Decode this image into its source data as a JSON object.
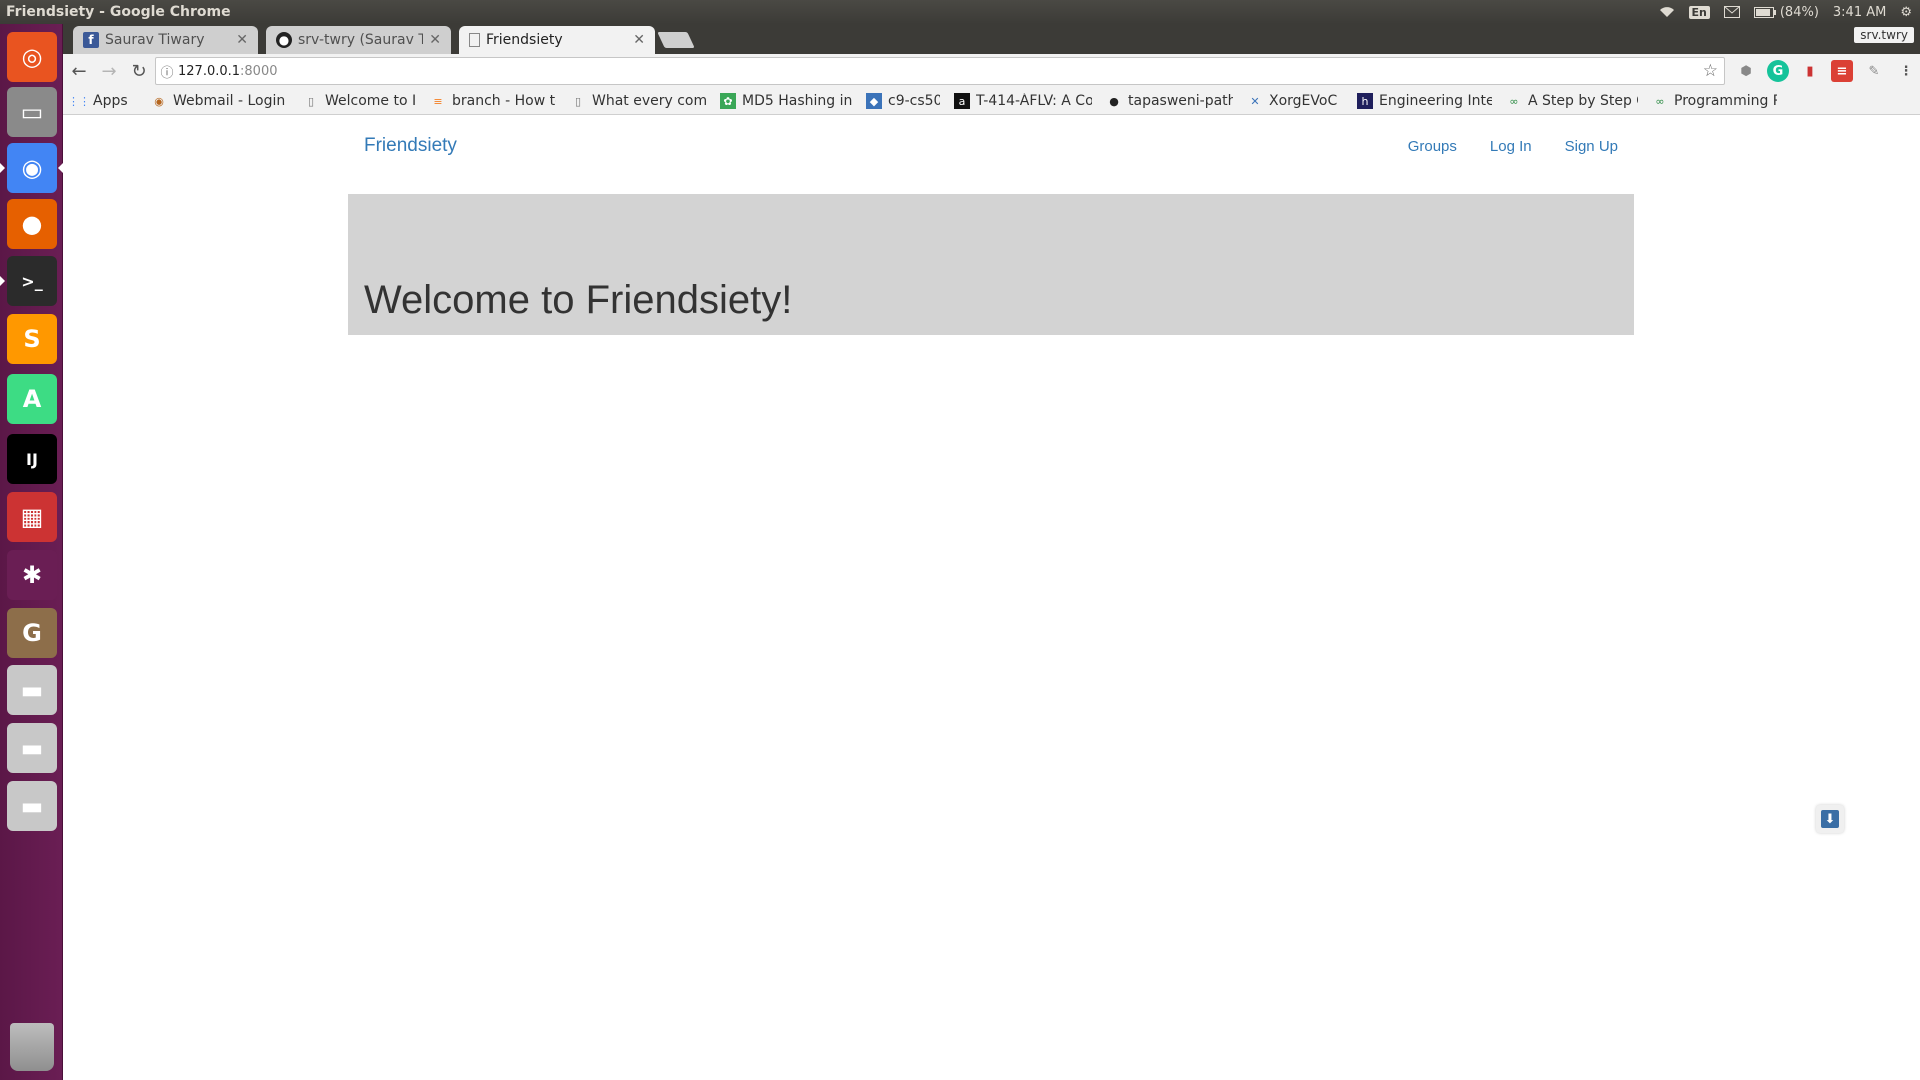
{
  "os": {
    "window_title": "Friendsiety - Google Chrome",
    "battery": "(84%)",
    "time": "3:41 AM",
    "language": "En"
  },
  "launcher": {
    "items": [
      {
        "name": "ubuntu-dash",
        "color": "#e95420",
        "glyph": "◎"
      },
      {
        "name": "files",
        "color": "#8a8a8a",
        "glyph": "▭"
      },
      {
        "name": "chrome",
        "color": "#4285f4",
        "glyph": "◉"
      },
      {
        "name": "firefox",
        "color": "#e66000",
        "glyph": "●"
      },
      {
        "name": "terminal",
        "color": "#2b2b2b",
        "glyph": ">_"
      },
      {
        "name": "sublime-text",
        "color": "#ff9800",
        "glyph": "S"
      },
      {
        "name": "android-studio",
        "color": "#3ddc84",
        "glyph": "A"
      },
      {
        "name": "intellij",
        "color": "#000000",
        "glyph": "IJ"
      },
      {
        "name": "colored-app",
        "color": "#cc3333",
        "glyph": "▦"
      },
      {
        "name": "network-app",
        "color": "#6a1e54",
        "glyph": "✱"
      },
      {
        "name": "gimp",
        "color": "#8d6e4a",
        "glyph": "G"
      },
      {
        "name": "drive-1",
        "color": "#c8c8c8",
        "glyph": "▬"
      },
      {
        "name": "drive-2",
        "color": "#c8c8c8",
        "glyph": "▬"
      },
      {
        "name": "drive-3",
        "color": "#c8c8c8",
        "glyph": "▬"
      }
    ]
  },
  "browser": {
    "tabs": [
      {
        "label": "Saurav Tiwary",
        "icon": "facebook-icon",
        "active": false
      },
      {
        "label": "srv-twry (Saurav Ti",
        "icon": "github-icon",
        "active": false
      },
      {
        "label": "Friendsiety",
        "icon": "page-icon",
        "active": true
      }
    ],
    "profile": "srv.twry",
    "url_host": "127.0.0.1",
    "url_port": ":8000",
    "bookmarks": [
      {
        "label": "Apps",
        "icon": "apps-grid-icon"
      },
      {
        "label": "Webmail - Login",
        "icon": "webmail-icon"
      },
      {
        "label": "Welcome to IIT P",
        "icon": "page-icon"
      },
      {
        "label": "branch - How to",
        "icon": "stackoverflow-icon"
      },
      {
        "label": "What every comp",
        "icon": "page-icon"
      },
      {
        "label": "MD5 Hashing in",
        "icon": "leaf-icon"
      },
      {
        "label": "c9-cs50",
        "icon": "c9-icon"
      },
      {
        "label": "T-414-ÁFLV: A Co",
        "icon": "a-icon"
      },
      {
        "label": "tapasweni-path",
        "icon": "github-icon"
      },
      {
        "label": "XorgEVoC",
        "icon": "xorg-icon"
      },
      {
        "label": "Engineering Inte",
        "icon": "h-icon"
      },
      {
        "label": "A Step by Step G",
        "icon": "gfg-icon"
      },
      {
        "label": "Programming P",
        "icon": "gfg-icon"
      }
    ]
  },
  "site": {
    "brand": "Friendsiety",
    "nav": {
      "groups": "Groups",
      "login": "Log In",
      "signup": "Sign Up"
    },
    "heading": "Welcome to Friendsiety!"
  }
}
